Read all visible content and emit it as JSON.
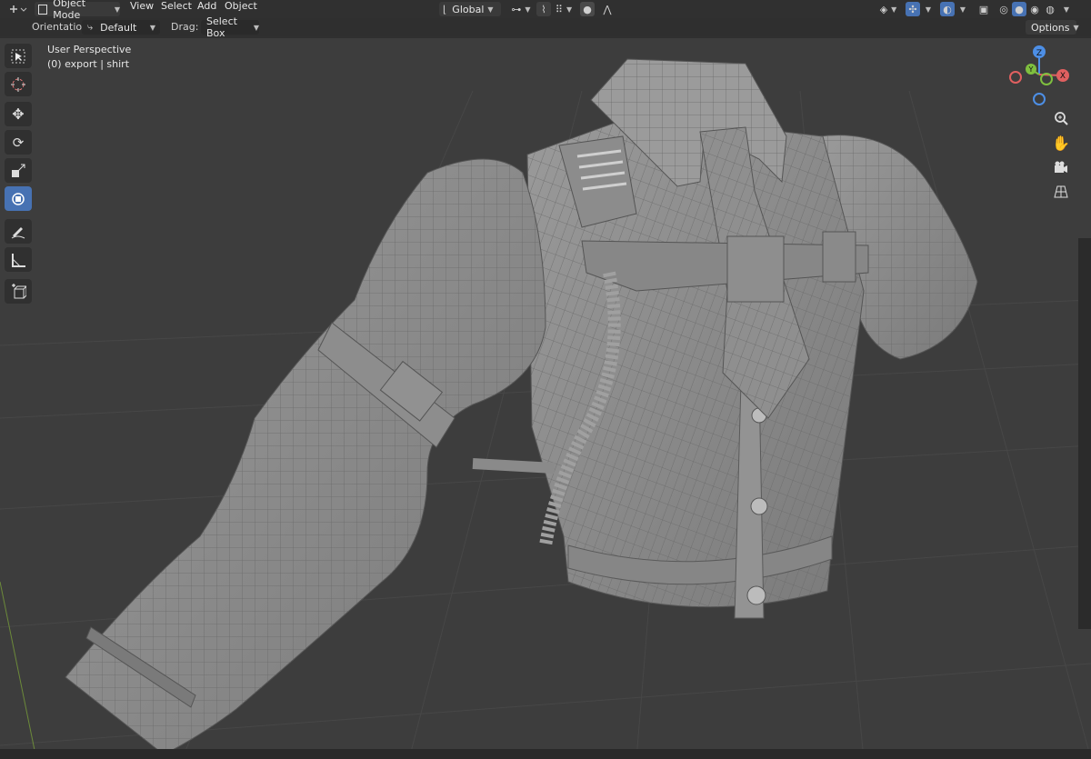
{
  "header": {
    "mode_label": "Object Mode",
    "menus": [
      "View",
      "Select",
      "Add",
      "Object"
    ],
    "transform_orientation": "Global",
    "orientation_label": "Orientation:",
    "orientation_value": "Default",
    "drag_label": "Drag:",
    "drag_value": "Select Box",
    "options_label": "Options"
  },
  "viewport": {
    "view_name": "User Perspective",
    "object_info": "(0) export | shirt"
  },
  "gizmo": {
    "z": "Z",
    "y": "Y",
    "x": "X"
  },
  "colors": {
    "active_tool": "#4772b3",
    "background": "#3d3d3d",
    "header": "#303030",
    "axis_x": "#e06060",
    "axis_y": "#7fbf3f",
    "axis_z": "#4d8fe6"
  }
}
